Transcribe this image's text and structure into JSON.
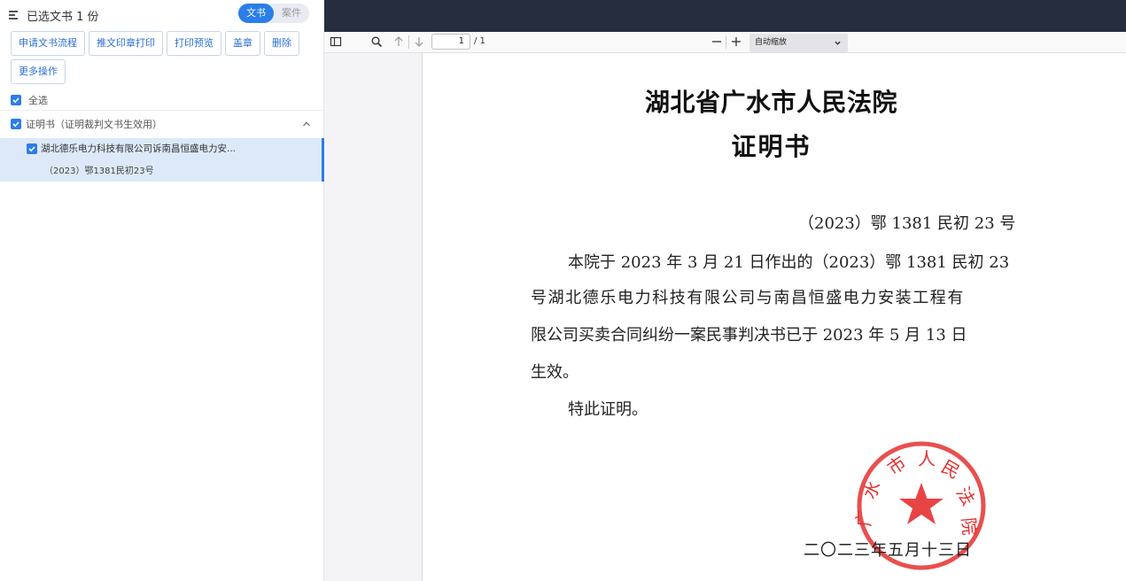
{
  "left_panel": {
    "title": "已选文书 1 份",
    "toggle": {
      "option_a": "文书",
      "option_b": "案件",
      "active": "文书"
    },
    "buttons": [
      "申请文书流程",
      "推文印章打印",
      "打印预览",
      "盖章",
      "删除"
    ],
    "more_button": "更多操作",
    "select_all": "全选",
    "group_label": "证明书（证明裁判文书生效用）",
    "doc_item": {
      "title": "湖北德乐电力科技有限公司诉南昌恒盛电力安...",
      "case_no": "（2023）鄂1381民初23号"
    },
    "accent_color": "#2b7de9"
  },
  "viewer": {
    "toolbar": {
      "page_current": "1",
      "page_total": "/ 1",
      "zoom_label": "自动缩放",
      "icons": [
        "sidebar-toggle-icon",
        "search-icon",
        "arrow-up-icon",
        "arrow-down-icon",
        "zoom-out-icon",
        "zoom-in-icon"
      ]
    },
    "document": {
      "court_name": "湖北省广水市人民法院",
      "doc_type": "证明书",
      "case_no": "（2023）鄂 1381 民初 23 号",
      "lines": [
        "本院于 2023 年 3 月 21 日作出的（2023）鄂 1381 民初 23",
        "号湖北德乐电力科技有限公司与南昌恒盛电力安装工程有",
        "限公司买卖合同纠纷一案民事判决书已于 2023 年 5 月 13 日",
        "生效。",
        "特此证明。"
      ],
      "date": "二〇二三年五月十三日",
      "seal_text": "湖北省广水市人民法院",
      "seal_color": "#e53030"
    }
  }
}
